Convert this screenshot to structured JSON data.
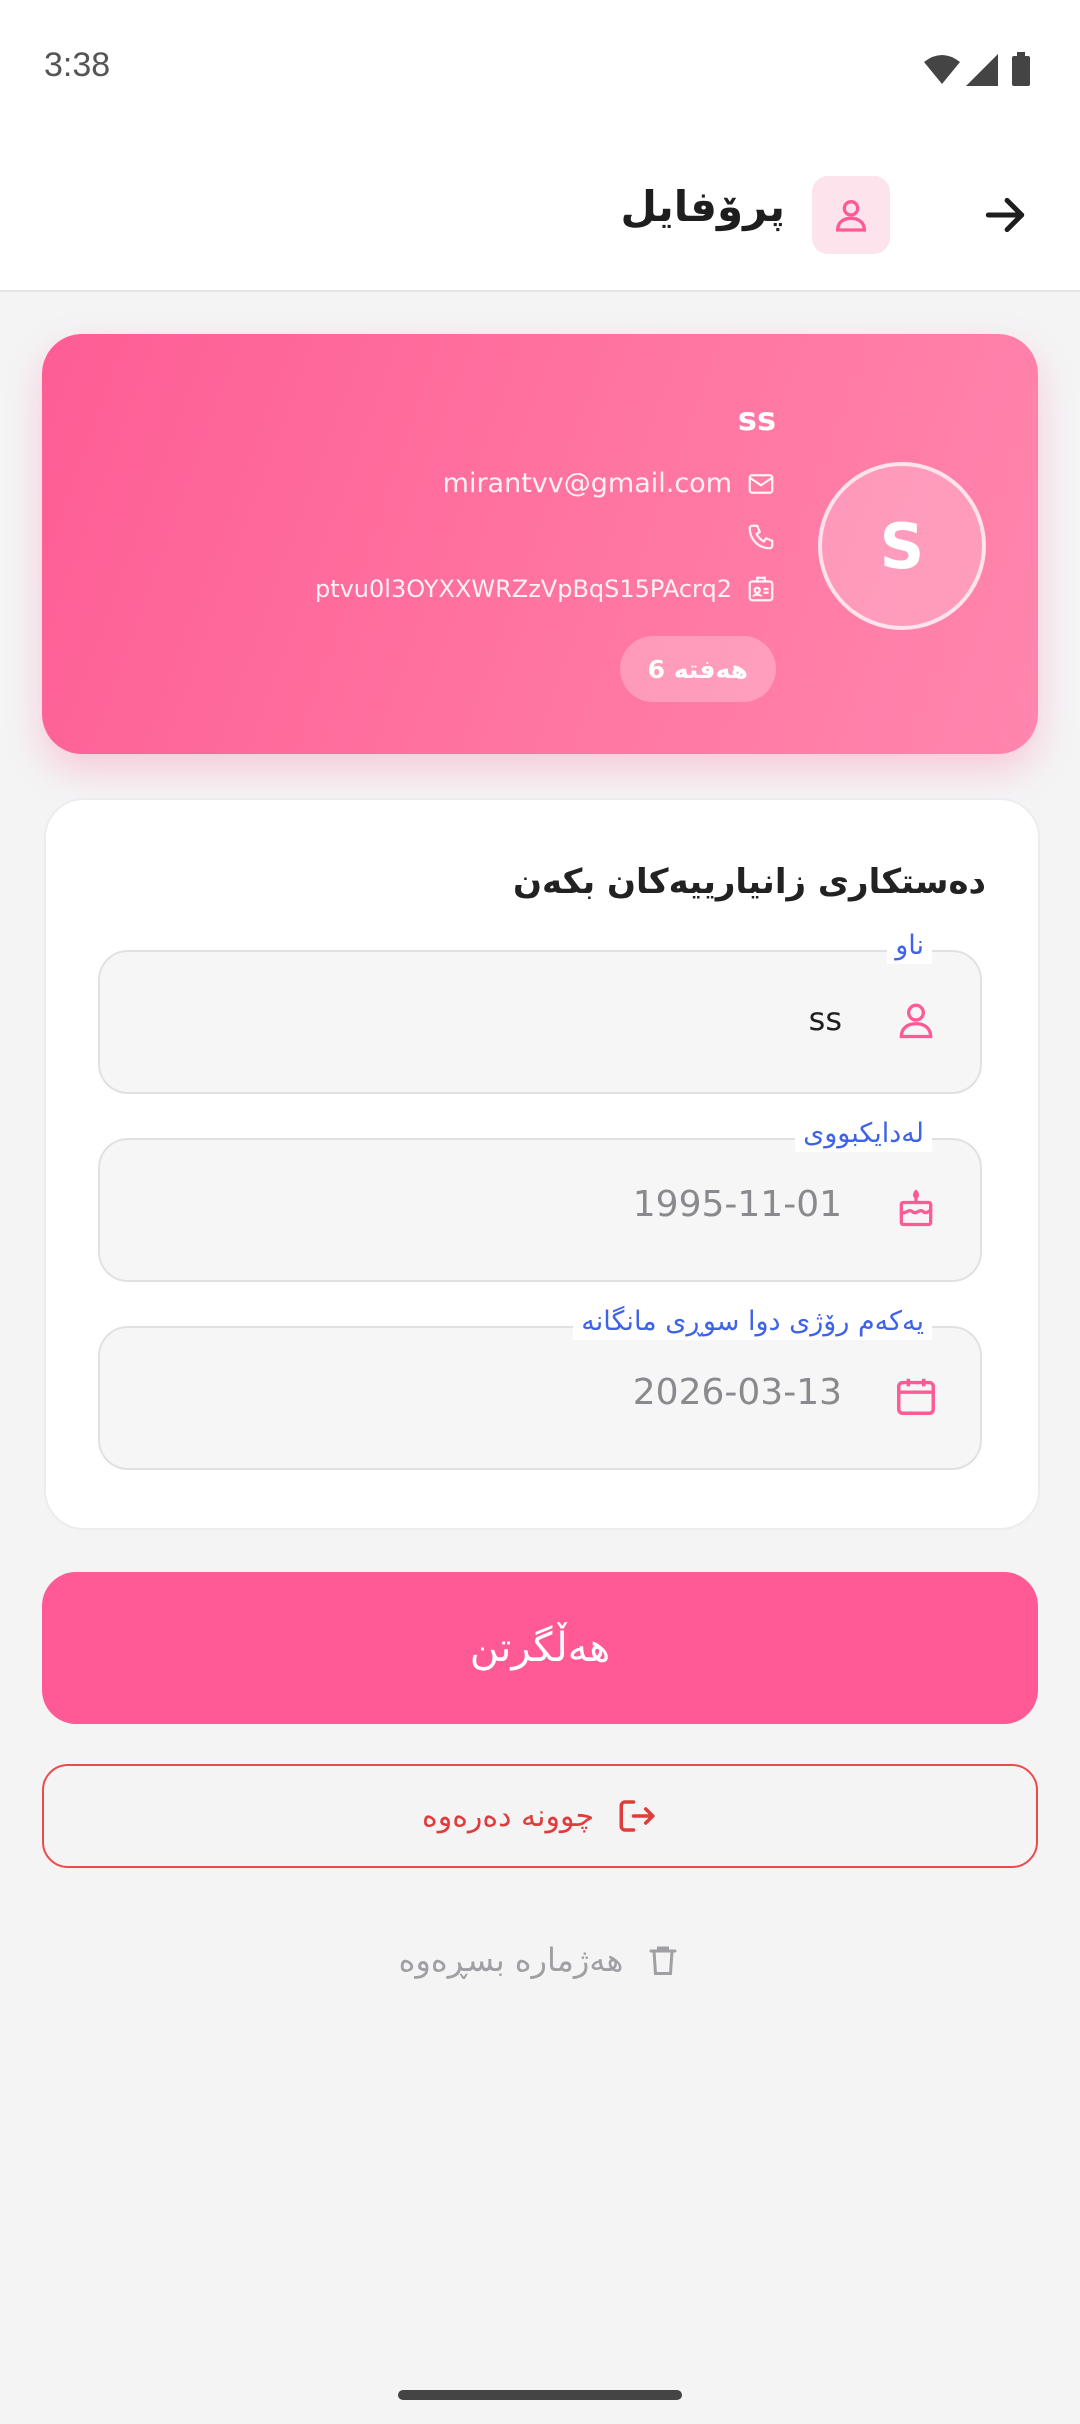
{
  "status_bar": {
    "time": "3:38"
  },
  "header": {
    "title": "پرۆفایل"
  },
  "profile": {
    "name": "ss",
    "email": "mirantvv@gmail.com",
    "phone": "",
    "user_id": "ptvu0l3OYXXWRZzVpBqS15PAcrq2",
    "avatar_letter": "S",
    "week_badge": "هەفتە 6"
  },
  "form": {
    "title": "دەستکاری زانیارییەکان بکەن",
    "fields": [
      {
        "label": "ناو",
        "value": "ss",
        "icon": "person-icon"
      },
      {
        "label": "لەدایکبووی",
        "value": "1995-11-01",
        "icon": "cake-icon"
      },
      {
        "label": "یەکەم رۆژی دوا سوڕی مانگانە",
        "value": "2026-03-13",
        "icon": "calendar-icon"
      }
    ]
  },
  "actions": {
    "save_label": "هەڵگرتن",
    "logout_label": "چوونە دەرەوە",
    "delete_label": "هەژمارە بسڕەوە"
  },
  "colors": {
    "accent": "#ff5a96",
    "accent_light": "#fde4ec",
    "label_blue": "#3f63e8",
    "danger": "#e03c3c"
  }
}
